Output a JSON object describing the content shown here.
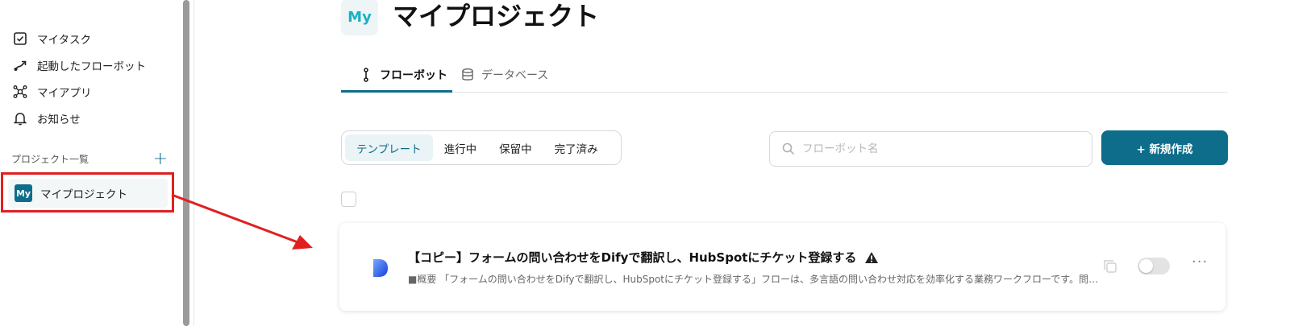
{
  "sidebar": {
    "nav": [
      {
        "label": "マイタスク",
        "icon": "checkbox-icon"
      },
      {
        "label": "起動したフローボット",
        "icon": "flow-arrow-icon"
      },
      {
        "label": "マイアプリ",
        "icon": "app-network-icon"
      },
      {
        "label": "お知らせ",
        "icon": "bell-icon"
      }
    ],
    "section_title": "プロジェクト一覧",
    "add_symbol": "+",
    "project": {
      "badge": "My",
      "label": "マイプロジェクト"
    }
  },
  "header": {
    "badge": "My",
    "title": "マイプロジェクト"
  },
  "tabs": [
    {
      "label": "フローボット",
      "icon": "flow-icon",
      "active": true
    },
    {
      "label": "データベース",
      "icon": "database-icon",
      "active": false
    }
  ],
  "filters": [
    {
      "label": "テンプレート",
      "active": true
    },
    {
      "label": "進行中",
      "active": false
    },
    {
      "label": "保留中",
      "active": false
    },
    {
      "label": "完了済み",
      "active": false
    }
  ],
  "search": {
    "placeholder": "フローボット名"
  },
  "new_button": {
    "label": "+ 新規作成"
  },
  "flowbots": [
    {
      "title": "【コピー】フォームの問い合わせをDifyで翻訳し、HubSpotにチケット登録する",
      "description": "■概要 「フォームの問い合わせをDifyで翻訳し、HubSpotにチケット登録する」フローは、多言語の問い合わせ対応を効率化する業務ワークフローです。問い合わせ…",
      "warning_icon": "warning-icon",
      "enabled": false,
      "more_label": "···"
    }
  ],
  "colors": {
    "accent": "#0e6d8a",
    "highlight": "#e02020",
    "badge_text": "#18b2c4"
  }
}
